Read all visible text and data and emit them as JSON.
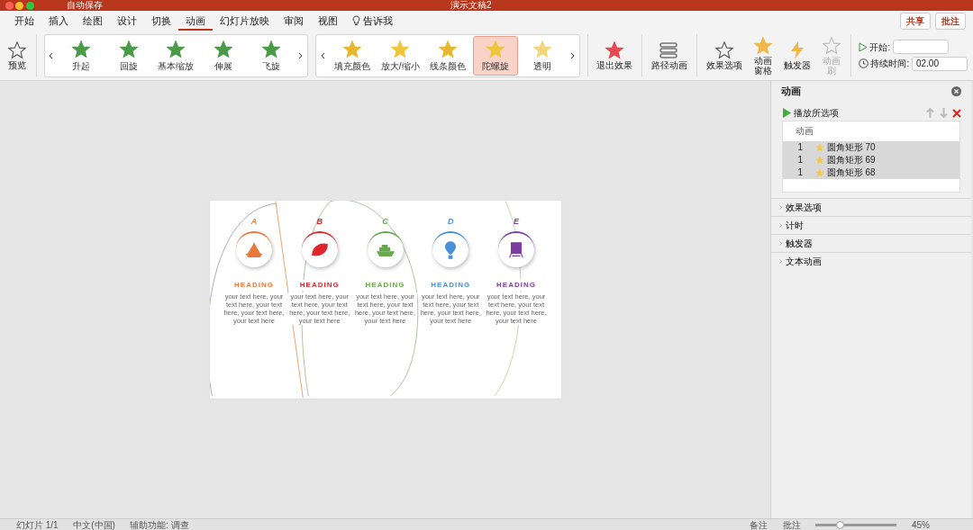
{
  "window": {
    "title": "演示文稿2",
    "autosave": "自动保存"
  },
  "tabs": [
    {
      "label": "开始",
      "selected": false
    },
    {
      "label": "插入",
      "selected": false
    },
    {
      "label": "绘图",
      "selected": false
    },
    {
      "label": "设计",
      "selected": false
    },
    {
      "label": "切换",
      "selected": false
    },
    {
      "label": "动画",
      "selected": true
    },
    {
      "label": "幻灯片放映",
      "selected": false
    },
    {
      "label": "审阅",
      "selected": false
    },
    {
      "label": "视图",
      "selected": false
    }
  ],
  "tell_me": "告诉我",
  "share_button": "共享",
  "comments_button": "批注",
  "ribbon": {
    "preview": "预览",
    "entrance_gallery": [
      {
        "label": "升起"
      },
      {
        "label": "回旋"
      },
      {
        "label": "基本缩放"
      },
      {
        "label": "伸展"
      },
      {
        "label": "飞旋"
      }
    ],
    "emphasis_gallery": [
      {
        "label": "填充颜色",
        "kind": "fill",
        "selected": false
      },
      {
        "label": "放大/缩小",
        "kind": "grow",
        "selected": false
      },
      {
        "label": "线条颜色",
        "kind": "line",
        "selected": false
      },
      {
        "label": "陀螺旋",
        "kind": "spin",
        "selected": true
      },
      {
        "label": "透明",
        "kind": "transparent",
        "selected": false
      }
    ],
    "tools": [
      {
        "label": "退出效果",
        "kind": "exit",
        "disabled": false
      },
      {
        "label": "路径动画",
        "kind": "path",
        "disabled": false
      },
      {
        "label": "效果选项",
        "kind": "options",
        "disabled": false
      },
      {
        "label": "动画窗格",
        "kind": "pane",
        "disabled": false
      },
      {
        "label": "触发器",
        "kind": "trigger",
        "disabled": false
      },
      {
        "label": "动画刷",
        "kind": "painter",
        "disabled": true
      }
    ],
    "start_label": "开始:",
    "duration_label": "持续时间:",
    "duration_value": "02.00"
  },
  "slide": {
    "items": [
      {
        "letter": "A",
        "color": "#e8793a",
        "kind": "sailboat",
        "heading": "HEADING",
        "body": "your text here, your text here, your text here, your text here, your text here"
      },
      {
        "letter": "B",
        "color": "#e0262b",
        "kind": "leaf",
        "heading": "HEADING",
        "body": "your text here, your text here, your text here, your text here, your text here"
      },
      {
        "letter": "C",
        "color": "#6aa84f",
        "kind": "ship",
        "heading": "HEADING",
        "body": "your text here, your text here, your text here, your text here, your text here"
      },
      {
        "letter": "D",
        "color": "#4a90d9",
        "kind": "balloon",
        "heading": "HEADING",
        "body": "your text here, your text here, your text here, your text here, your text here"
      },
      {
        "letter": "E",
        "color": "#7b3fa0",
        "kind": "train",
        "heading": "HEADING",
        "body": "your text here, your text here, your text here, your text here, your text here"
      }
    ]
  },
  "pane": {
    "title": "动画",
    "play_button": "播放所选项",
    "list_header": "动画",
    "items": [
      {
        "order": "1",
        "name": "圆角矩形 70",
        "selected": true
      },
      {
        "order": "1",
        "name": "圆角矩形 69",
        "selected": true
      },
      {
        "order": "1",
        "name": "圆角矩形 68",
        "selected": true
      }
    ],
    "sections": [
      {
        "label": "效果选项",
        "expanded": false
      },
      {
        "label": "计时",
        "expanded": false
      },
      {
        "label": "触发器",
        "expanded": false
      },
      {
        "label": "文本动画",
        "expanded": false
      }
    ]
  },
  "status_bar": {
    "slide": "幻灯片 1/1",
    "language": "中文(中国)",
    "accessibility": "辅助功能: 调查",
    "notes": "备注",
    "comments": "批注",
    "zoom_slider": {
      "level": 0.3
    },
    "zoom": "45%"
  }
}
